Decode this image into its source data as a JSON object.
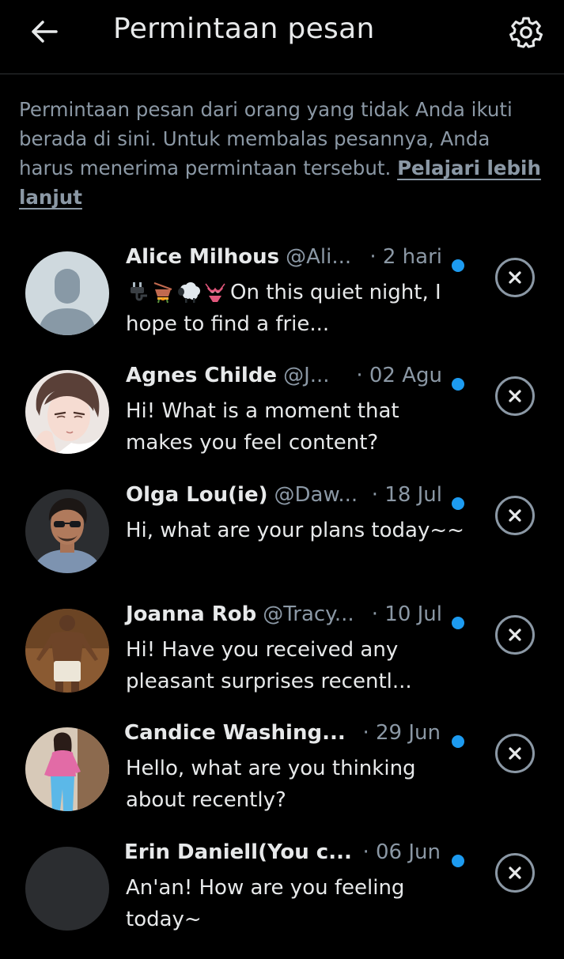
{
  "header": {
    "title": "Permintaan pesan",
    "back_icon": "arrow-left-icon",
    "settings_icon": "gear-icon"
  },
  "info": {
    "text": "Permintaan pesan dari orang yang tidak Anda ikuti berada di sini. Untuk membalas pesannya, Anda harus menerima permintaan tersebut.",
    "link": "Pelajari lebih lanjut"
  },
  "colors": {
    "background": "#000000",
    "primary_text": "#e7e9ea",
    "secondary_text": "#8b98a5",
    "unread_dot": "#1d9bf0"
  },
  "requests": [
    {
      "name": "Alice Milhous",
      "handle": "@Ali...",
      "date": "· 2 hari",
      "emojis": [
        "plug",
        "hot-pot",
        "sheep",
        "bikini"
      ],
      "message": "On this quiet night, I hope to find a frie...",
      "unread": true,
      "avatar": "default-profile-icon"
    },
    {
      "name": "Agnes Childe",
      "handle": "@J...",
      "date": "· 02 Agu",
      "message": "Hi! What is a moment that makes you feel content?",
      "unread": true,
      "avatar": "anime-portrait"
    },
    {
      "name": "Olga Lou(ie)",
      "handle": "@Daw...",
      "date": "· 18 Jul",
      "message": "Hi, what are your plans today~~",
      "unread": true,
      "avatar": "man-sunglasses-photo"
    },
    {
      "name": "Joanna Rob",
      "handle": "@Tracy...",
      "date": "· 10 Jul",
      "message": "Hi! Have you received any pleasant surprises recentl...",
      "unread": true,
      "avatar": "shirtless-man-photo"
    },
    {
      "name": "Candice Washing...",
      "handle": "",
      "date": "· 29 Jun",
      "message": "Hello, what are you thinking about recently?",
      "unread": true,
      "avatar": "woman-pink-shirt-photo"
    },
    {
      "name": "Erin Daniell(You c...",
      "handle": "",
      "date": "· 06 Jun",
      "message": "An'an! How are you feeling today~",
      "unread": true,
      "avatar": "blank-dark-avatar"
    }
  ]
}
